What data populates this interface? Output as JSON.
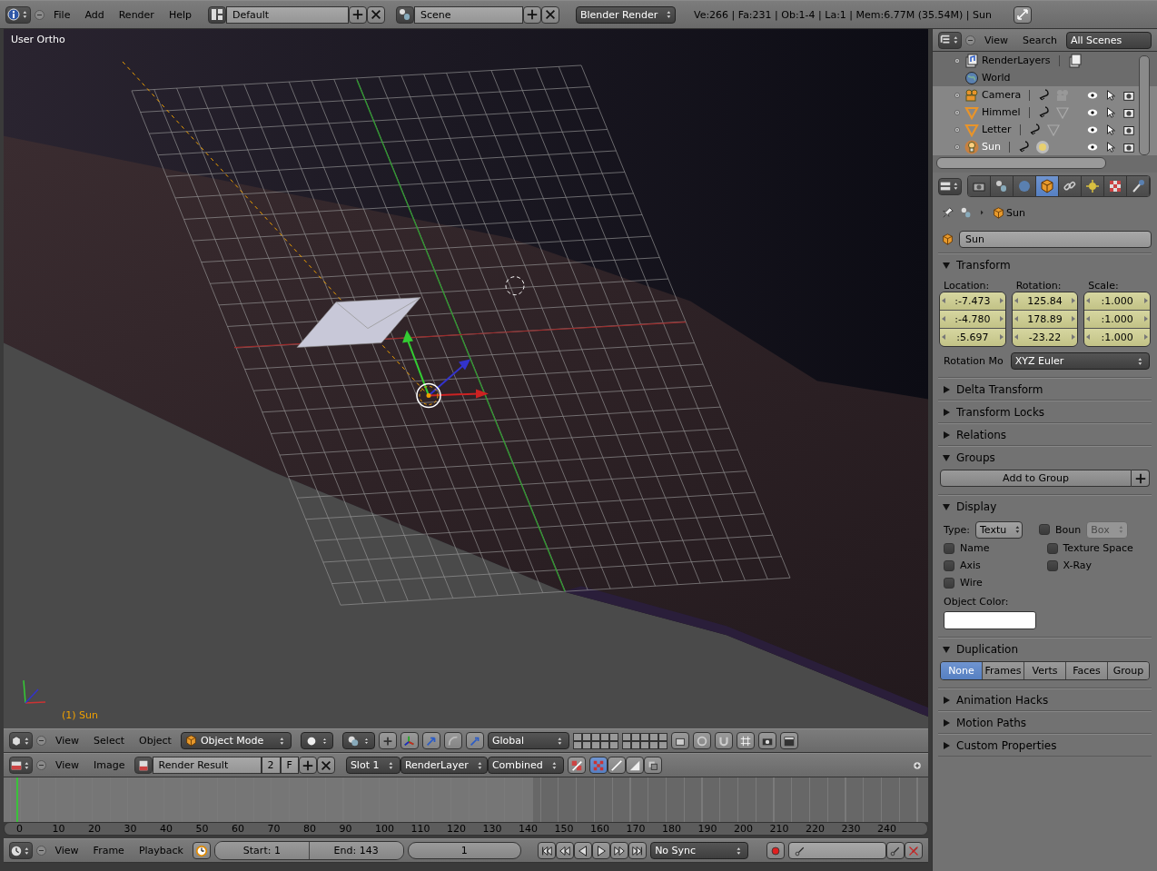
{
  "top_bar": {
    "menus": [
      "File",
      "Add",
      "Render",
      "Help"
    ],
    "screen_layout": "Default",
    "scene": "Scene",
    "render_engine": "Blender Render",
    "stats": "Ve:266 | Fa:231 | Ob:1-4 | La:1 | Mem:6.77M (35.54M) | Sun"
  },
  "viewport": {
    "view_name": "User Ortho",
    "object_info": "(1) Sun"
  },
  "viewport_header": {
    "menus": [
      "View",
      "Select",
      "Object"
    ],
    "mode": "Object Mode",
    "orientation": "Global"
  },
  "image_editor_header": {
    "menus": [
      "View",
      "Image"
    ],
    "image": "Render Result",
    "users": "2",
    "fake_user": "F",
    "slot": "Slot 1",
    "render_layer": "RenderLayer",
    "pass": "Combined"
  },
  "timeline": {
    "ticks": [
      "0",
      "10",
      "20",
      "30",
      "40",
      "50",
      "60",
      "70",
      "80",
      "90",
      "100",
      "110",
      "120",
      "130",
      "140",
      "150",
      "160",
      "170",
      "180",
      "190",
      "200",
      "210",
      "220",
      "230",
      "240"
    ]
  },
  "timeline_header": {
    "menus": [
      "View",
      "Frame",
      "Playback"
    ],
    "start": "Start: 1",
    "end": "End: 143",
    "current_frame": "1",
    "sync": "No Sync"
  },
  "outliner": {
    "menus": [
      "View",
      "Search"
    ],
    "display_mode": "All Scenes",
    "items": [
      {
        "name": "RenderLayers",
        "kind": "render_layers",
        "selected": false,
        "active": false
      },
      {
        "name": "World",
        "kind": "world",
        "selected": false,
        "active": false
      },
      {
        "name": "Camera",
        "kind": "camera",
        "selected": true,
        "active": false
      },
      {
        "name": "Himmel",
        "kind": "mesh",
        "selected": true,
        "active": false
      },
      {
        "name": "Letter",
        "kind": "mesh",
        "selected": true,
        "active": false
      },
      {
        "name": "Sun",
        "kind": "lamp",
        "selected": true,
        "active": true
      }
    ]
  },
  "properties": {
    "tabs": [
      {
        "kind": "render",
        "selected": false
      },
      {
        "kind": "scene",
        "selected": false
      },
      {
        "kind": "world",
        "selected": false
      },
      {
        "kind": "object",
        "selected": true
      },
      {
        "kind": "constraints",
        "selected": false
      },
      {
        "kind": "data",
        "selected": false
      },
      {
        "kind": "texture",
        "selected": false
      },
      {
        "kind": "physics",
        "selected": false
      }
    ],
    "context_path": "Sun",
    "object_name": "Sun",
    "panels": [
      {
        "kind": "transform",
        "title": "Transform",
        "expanded": true,
        "columns": [
          {
            "label": "Location:",
            "values": [
              ":-7.473",
              ":-4.780",
              ":5.697"
            ]
          },
          {
            "label": "Rotation:",
            "values": [
              "125.84",
              "178.89",
              "-23.22"
            ]
          },
          {
            "label": "Scale:",
            "values": [
              ":1.000",
              ":1.000",
              ":1.000"
            ]
          }
        ],
        "rotation_mode_label": "Rotation Mo",
        "rotation_mode": "XYZ Euler"
      },
      {
        "kind": "plain",
        "title": "Delta Transform",
        "expanded": false
      },
      {
        "kind": "plain",
        "title": "Transform Locks",
        "expanded": false
      },
      {
        "kind": "plain",
        "title": "Relations",
        "expanded": false
      },
      {
        "kind": "groups",
        "title": "Groups",
        "expanded": true,
        "button": "Add to Group"
      },
      {
        "kind": "display",
        "title": "Display",
        "expanded": true,
        "type_label": "Type:",
        "type": "Textu",
        "bounds": {
          "label": "Boun",
          "checked": false
        },
        "bounds_type": {
          "value": "Box",
          "disabled": true
        },
        "checkboxes": [
          {
            "label": "Name",
            "checked": false
          },
          {
            "label": "Texture Space",
            "checked": false
          },
          {
            "label": "Axis",
            "checked": false
          },
          {
            "label": "X-Ray",
            "checked": false
          },
          {
            "label": "Wire",
            "checked": false
          }
        ],
        "color_label": "Object Color:"
      },
      {
        "kind": "duplication",
        "title": "Duplication",
        "expanded": true,
        "options": [
          {
            "label": "None",
            "selected": true
          },
          {
            "label": "Frames",
            "selected": false
          },
          {
            "label": "Verts",
            "selected": false
          },
          {
            "label": "Faces",
            "selected": false
          },
          {
            "label": "Group",
            "selected": false
          }
        ]
      },
      {
        "kind": "plain",
        "title": "Animation Hacks",
        "expanded": false
      },
      {
        "kind": "plain",
        "title": "Motion Paths",
        "expanded": false
      },
      {
        "kind": "plain",
        "title": "Custom Properties",
        "expanded": false
      }
    ]
  }
}
